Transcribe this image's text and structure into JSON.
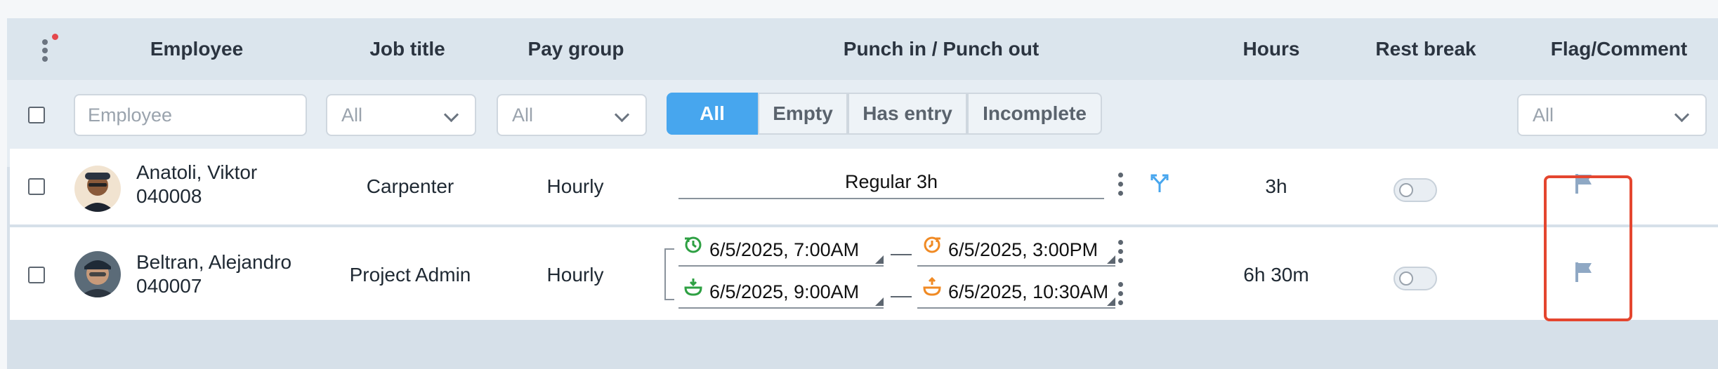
{
  "header": {
    "columns": {
      "employee": "Employee",
      "job_title": "Job title",
      "pay_group": "Pay group",
      "punch": "Punch in / Punch out",
      "hours": "Hours",
      "rest_break": "Rest break",
      "flag_comment": "Flag/Comment"
    }
  },
  "filters": {
    "employee_placeholder": "Employee",
    "job_title_value": "All",
    "pay_group_value": "All",
    "flag_value": "All",
    "punch_segments": [
      "All",
      "Empty",
      "Has entry",
      "Incomplete"
    ],
    "punch_active": "All"
  },
  "rows": [
    {
      "name": "Anatoli, Viktor",
      "emp_id": "040008",
      "job_title": "Carpenter",
      "pay_group": "Hourly",
      "punch_summary": "Regular 3h",
      "hours": "3h"
    },
    {
      "name": "Beltran, Alejandro",
      "emp_id": "040007",
      "job_title": "Project Admin",
      "pay_group": "Hourly",
      "punch_in": "6/5/2025, 7:00AM",
      "punch_out": "6/5/2025, 3:00PM",
      "break_start": "6/5/2025, 9:00AM",
      "break_end": "6/5/2025, 10:30AM",
      "hours": "6h 30m"
    }
  ],
  "colors": {
    "accent": "#47a6ee",
    "highlight": "#e4462f",
    "punch_in": "#2ea043",
    "punch_out": "#f08a24",
    "flag": "#8fa8c4"
  },
  "icons": [
    "kebab-menu-icon",
    "chevron-down-icon",
    "split-icon",
    "clock-in-icon",
    "clock-out-icon",
    "break-start-icon",
    "break-end-icon",
    "flag-icon"
  ]
}
